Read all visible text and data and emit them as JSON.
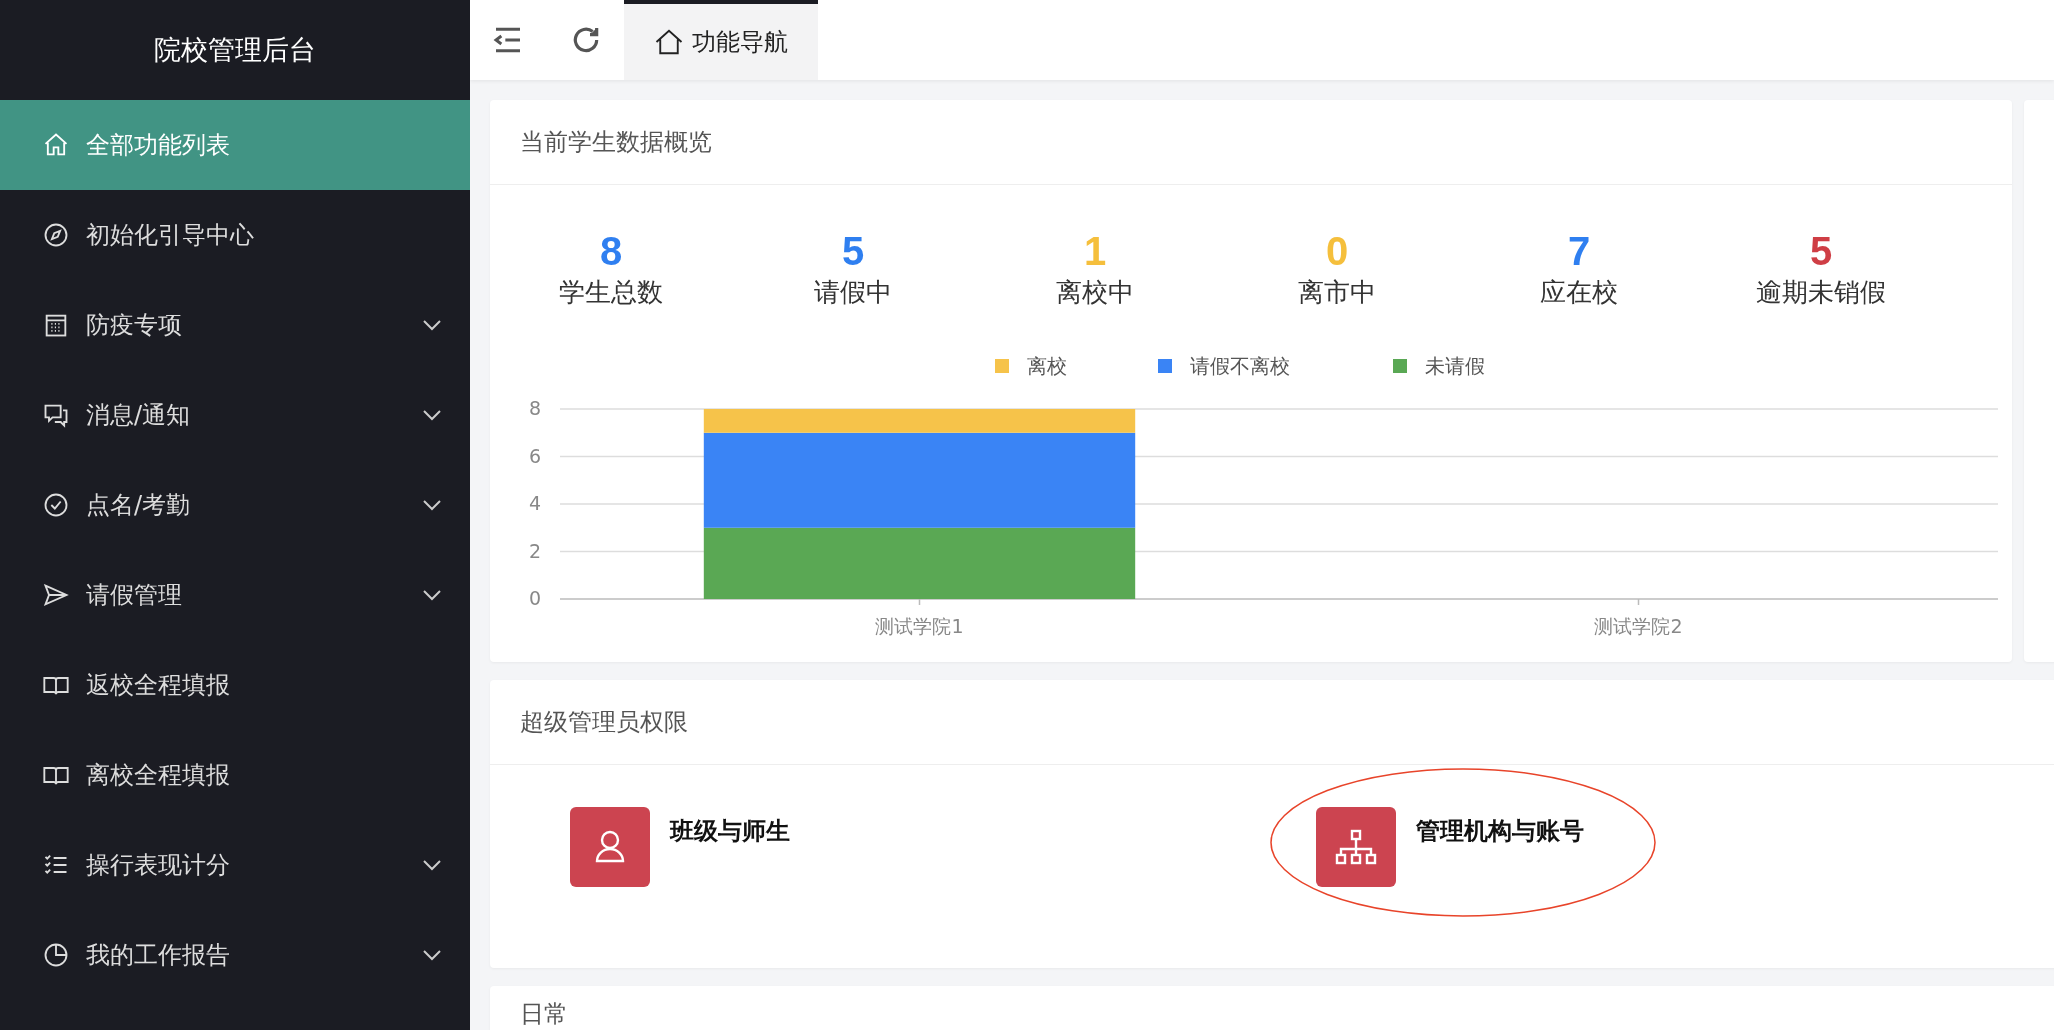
{
  "sidebar": {
    "title": "院校管理后台",
    "items": [
      {
        "label": "全部功能列表",
        "kind": "link",
        "selected": true
      },
      {
        "label": "初始化引导中心",
        "kind": "link",
        "selected": false
      },
      {
        "label": "防疫专项",
        "kind": "submenu",
        "selected": false,
        "expanded": false
      },
      {
        "label": "消息/通知",
        "kind": "submenu",
        "selected": false,
        "expanded": false
      },
      {
        "label": "点名/考勤",
        "kind": "submenu",
        "selected": false,
        "expanded": false
      },
      {
        "label": "请假管理",
        "kind": "submenu",
        "selected": false,
        "expanded": false
      },
      {
        "label": "返校全程填报",
        "kind": "link",
        "selected": false
      },
      {
        "label": "离校全程填报",
        "kind": "link",
        "selected": false
      },
      {
        "label": "操行表现计分",
        "kind": "submenu",
        "selected": false,
        "expanded": false
      },
      {
        "label": "我的工作报告",
        "kind": "submenu",
        "selected": false,
        "expanded": false
      }
    ]
  },
  "tabs": [
    {
      "label": "功能导航",
      "selected": true
    }
  ],
  "overview": {
    "title": "当前学生数据概览",
    "stats": [
      {
        "value": "8",
        "label": "学生总数",
        "color": "#2f7ff0"
      },
      {
        "value": "5",
        "label": "请假中",
        "color": "#2f7ff0"
      },
      {
        "value": "1",
        "label": "离校中",
        "color": "#f5bf3c"
      },
      {
        "value": "0",
        "label": "离市中",
        "color": "#f5bf3c"
      },
      {
        "value": "7",
        "label": "应在校",
        "color": "#2f7ff0"
      },
      {
        "value": "5",
        "label": "逾期未销假",
        "color": "#cf3e45"
      }
    ],
    "chart_data": {
      "type": "bar",
      "stacked": true,
      "grid": true,
      "legend": true,
      "categories": [
        "测试学院1",
        "测试学院2"
      ],
      "ylim": [
        0,
        8
      ],
      "yticks": [
        0,
        2,
        4,
        6,
        8
      ],
      "series": [
        {
          "name": "离校",
          "color": "#f6c34a",
          "values": [
            1,
            0
          ]
        },
        {
          "name": "请假不离校",
          "color": "#3a84f5",
          "values": [
            4,
            0
          ]
        },
        {
          "name": "未请假",
          "color": "#5aa854",
          "values": [
            3,
            0
          ]
        }
      ]
    }
  },
  "admin": {
    "title": "超级管理员权限",
    "items": [
      {
        "label": "班级与师生"
      },
      {
        "label": "管理机构与账号"
      }
    ]
  },
  "daily": {
    "title": "日常"
  }
}
